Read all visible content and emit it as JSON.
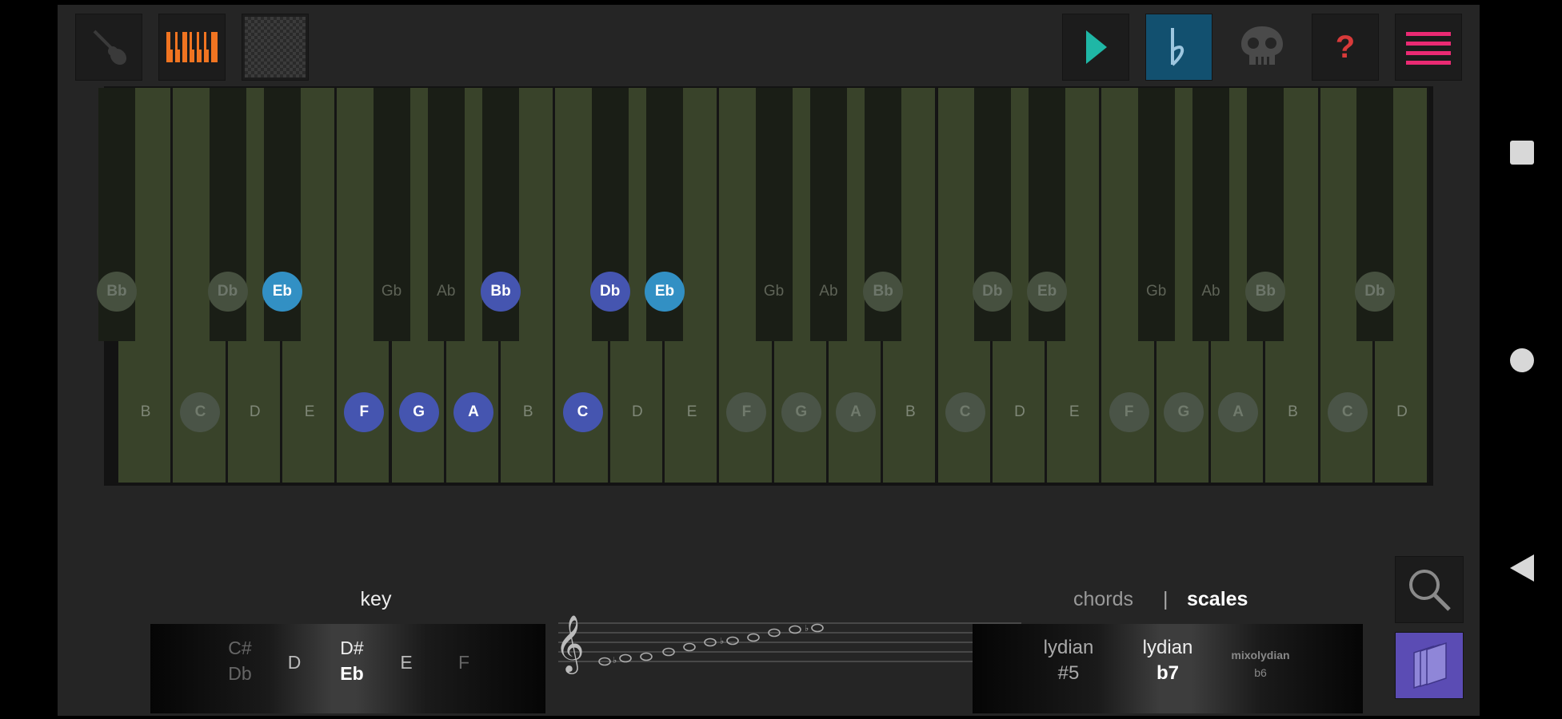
{
  "toolbar": {
    "guitar_view": "guitar-icon",
    "piano_view": "piano-icon",
    "grid_view": "grid-icon",
    "play": "play-icon",
    "flat_toggle": "flat-icon",
    "skull": "skull-icon",
    "help_label": "?",
    "menu": "menu-icon"
  },
  "piano": {
    "white_keys": [
      {
        "note": "B",
        "state": "plain"
      },
      {
        "note": "C",
        "state": "dim"
      },
      {
        "note": "D",
        "state": "plain"
      },
      {
        "note": "E",
        "state": "plain"
      },
      {
        "note": "F",
        "state": "selected"
      },
      {
        "note": "G",
        "state": "selected"
      },
      {
        "note": "A",
        "state": "selected"
      },
      {
        "note": "B",
        "state": "plain"
      },
      {
        "note": "C",
        "state": "selected"
      },
      {
        "note": "D",
        "state": "plain"
      },
      {
        "note": "E",
        "state": "plain"
      },
      {
        "note": "F",
        "state": "dim"
      },
      {
        "note": "G",
        "state": "dim"
      },
      {
        "note": "A",
        "state": "dim"
      },
      {
        "note": "B",
        "state": "plain"
      },
      {
        "note": "C",
        "state": "dim"
      },
      {
        "note": "D",
        "state": "plain"
      },
      {
        "note": "E",
        "state": "plain"
      },
      {
        "note": "F",
        "state": "dim"
      },
      {
        "note": "G",
        "state": "dim"
      },
      {
        "note": "A",
        "state": "dim"
      },
      {
        "note": "B",
        "state": "plain"
      },
      {
        "note": "C",
        "state": "dim"
      },
      {
        "note": "D",
        "state": "plain"
      }
    ],
    "black_keys": [
      {
        "note": "Bb",
        "state": "dim"
      },
      {
        "note": "Db",
        "state": "dim"
      },
      {
        "note": "Eb",
        "state": "root"
      },
      {
        "note": "Gb",
        "state": "plain"
      },
      {
        "note": "Ab",
        "state": "plain"
      },
      {
        "note": "Bb",
        "state": "selected"
      },
      {
        "note": "Db",
        "state": "selected"
      },
      {
        "note": "Eb",
        "state": "root"
      },
      {
        "note": "Gb",
        "state": "plain"
      },
      {
        "note": "Ab",
        "state": "plain"
      },
      {
        "note": "Bb",
        "state": "dim"
      },
      {
        "note": "Db",
        "state": "dim"
      },
      {
        "note": "Eb",
        "state": "dim"
      },
      {
        "note": "Gb",
        "state": "plain"
      },
      {
        "note": "Ab",
        "state": "plain"
      },
      {
        "note": "Bb",
        "state": "dim"
      },
      {
        "note": "Db",
        "state": "dim"
      }
    ]
  },
  "key_panel": {
    "title": "key",
    "items": [
      {
        "top": "C#",
        "bottom": "Db"
      },
      {
        "top": "D",
        "bottom": ""
      },
      {
        "top": "D#",
        "bottom": "Eb"
      },
      {
        "top": "E",
        "bottom": ""
      },
      {
        "top": "F",
        "bottom": ""
      }
    ]
  },
  "chords_scales": {
    "chords_label": "chords",
    "separator": "|",
    "scales_label": "scales",
    "items": [
      {
        "top": "lydian",
        "bottom": "#5"
      },
      {
        "top": "lydian",
        "bottom": "b7"
      },
      {
        "top": "mixolydian",
        "bottom": "b6"
      }
    ]
  },
  "search_icon": "magnifier-icon",
  "library_icon": "books-icon",
  "system_nav": {
    "recents": "square-icon",
    "home": "circle-icon",
    "back": "triangle-icon"
  },
  "colors": {
    "selected": "#4555b0",
    "root": "#3290c4",
    "play": "#1fb7a6",
    "accent_pink": "#ea2a73",
    "help_red": "#d83a3a",
    "library": "#5b4cb4"
  }
}
